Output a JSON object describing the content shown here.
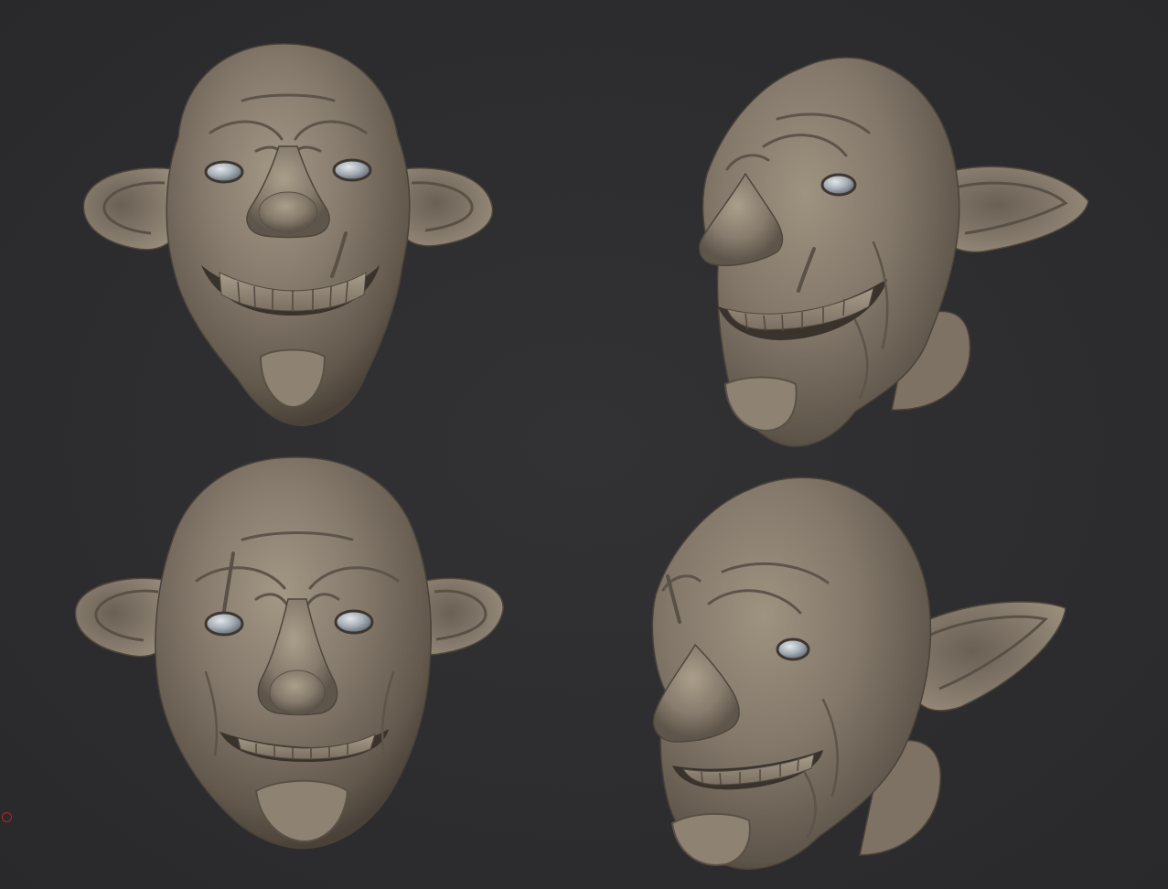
{
  "scene": {
    "background_color": "#2e2e30",
    "clay_color": "#857a6c",
    "clay_highlight": "#a19583",
    "clay_shadow": "#4c443b",
    "eye_color": "#9aa3ad",
    "pivot_marker_color": "#b3262b",
    "renders": [
      {
        "name": "front-view-smile",
        "view": "front",
        "expression": "smile"
      },
      {
        "name": "three-quarter-view-smile",
        "view": "three-quarter",
        "expression": "smile"
      },
      {
        "name": "front-view-grin",
        "view": "front",
        "expression": "grin"
      },
      {
        "name": "three-quarter-view-grin",
        "view": "three-quarter",
        "expression": "grin"
      }
    ]
  }
}
